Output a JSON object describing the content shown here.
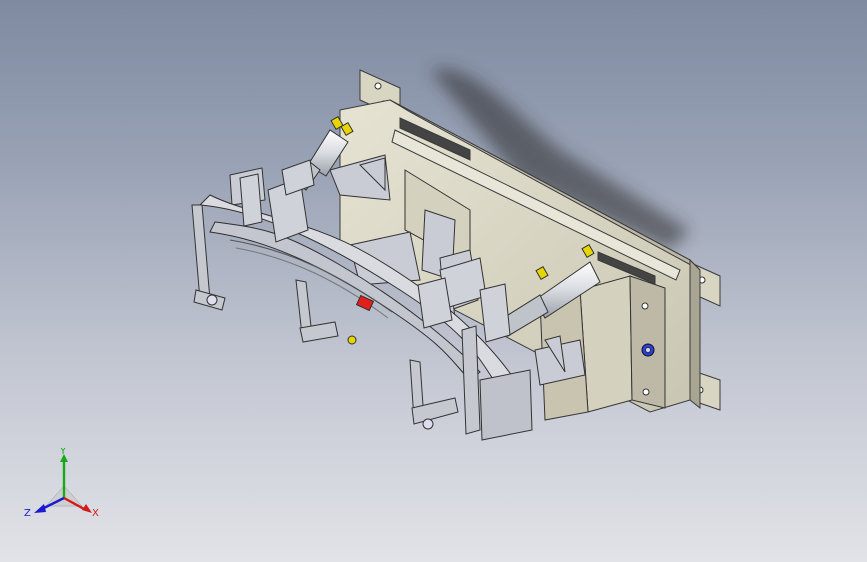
{
  "viewport": {
    "background_top": "#7f8aa0",
    "background_bottom": "#e2e3e8"
  },
  "model": {
    "plate_color": "#d9d6c4",
    "steel_color": "#c9ccd4",
    "cylinder_color": "#e9ecf0",
    "highlight_red": "#e0201c",
    "port_blue": "#2a3fd6",
    "fitting_yellow": "#e8d400"
  },
  "triad": {
    "x_label": "X",
    "y_label": "Y",
    "z_label": "Z",
    "x_color": "#d21a1a",
    "y_color": "#1aa81a",
    "z_color": "#1a1ad2"
  }
}
